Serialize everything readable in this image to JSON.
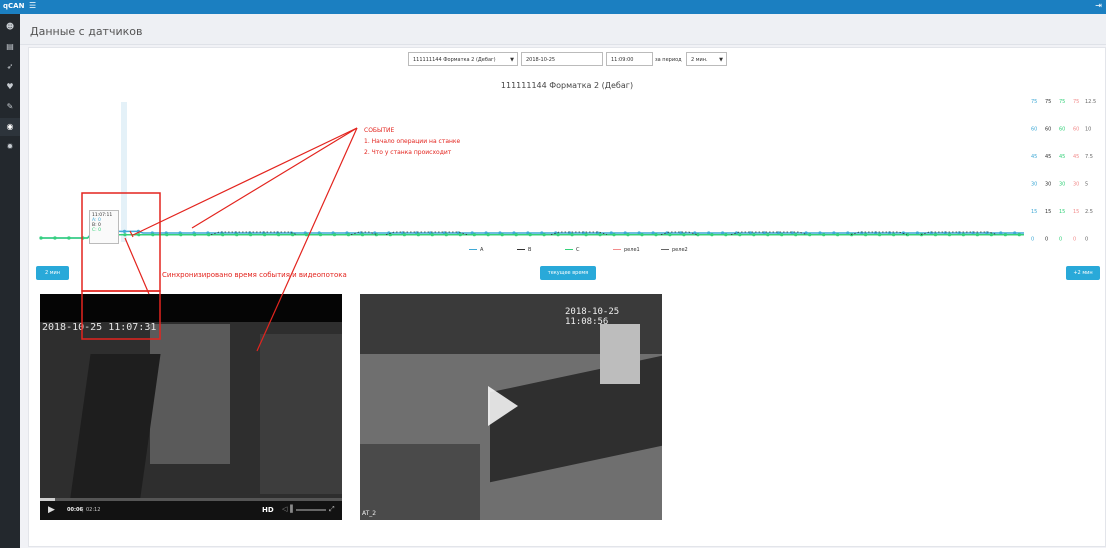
{
  "app": {
    "brand": "qCAN"
  },
  "page": {
    "title": "Данные с датчиков"
  },
  "filters": {
    "device": "111111144 Форматка 2 (Дебаг)",
    "date": "2018-10-25",
    "time": "11:09:00",
    "period_label": "за период",
    "period": "2 мин."
  },
  "chart": {
    "title": "111111144 Форматка 2 (Дебаг)",
    "legend": [
      {
        "name": "A",
        "color": "#3fa9d6"
      },
      {
        "name": "B",
        "color": "#333333"
      },
      {
        "name": "C",
        "color": "#35d17a"
      },
      {
        "name": "реле1",
        "color": "#f28c8c"
      },
      {
        "name": "реле2",
        "color": "#666666"
      }
    ],
    "right_axis_columns": [
      {
        "color": "#3fa9d6",
        "ticks": [
          "75",
          "60",
          "45",
          "30",
          "15",
          "0"
        ]
      },
      {
        "color": "#333333",
        "ticks": [
          "75",
          "60",
          "45",
          "30",
          "15",
          "0"
        ]
      },
      {
        "color": "#35d17a",
        "ticks": [
          "75",
          "60",
          "45",
          "30",
          "15",
          "0"
        ]
      },
      {
        "color": "#f28c8c",
        "ticks": [
          "75",
          "60",
          "45",
          "30",
          "15",
          "0"
        ]
      },
      {
        "color": "#666666",
        "ticks": [
          "12.5",
          "10",
          "7.5",
          "5",
          "2.5",
          "0"
        ]
      }
    ],
    "tooltip": {
      "time": "11:07:11",
      "rows": [
        "A: 0",
        "B: 0",
        "C: 0"
      ]
    }
  },
  "chart_data": {
    "type": "line",
    "series": [
      {
        "name": "A",
        "values": [
          0,
          0,
          0,
          0,
          0,
          0,
          0,
          0,
          0,
          0,
          0,
          3,
          4,
          4,
          4,
          4,
          4,
          4,
          4,
          4,
          4,
          4,
          3,
          3,
          3,
          3,
          3,
          3,
          3,
          3,
          3,
          3,
          3,
          3,
          3,
          3,
          3,
          3,
          3,
          3,
          3,
          3,
          3,
          3,
          3,
          3,
          3,
          3,
          3,
          3,
          3,
          3,
          3,
          3,
          3,
          3,
          3,
          3,
          3,
          3,
          3,
          3,
          3,
          3,
          3,
          3,
          3,
          3,
          3,
          3,
          3,
          3,
          3,
          3,
          3,
          3,
          3,
          3,
          3,
          3,
          3,
          3,
          3,
          3,
          3,
          3,
          3,
          3,
          3,
          3,
          3,
          3,
          3,
          3,
          3,
          3,
          3,
          3,
          3,
          3,
          3,
          3,
          3,
          3,
          3,
          3,
          3,
          3,
          3,
          3,
          3,
          3,
          3,
          3,
          3,
          3,
          3,
          3,
          3,
          3,
          3,
          3,
          3,
          3,
          3,
          3,
          3,
          3,
          3,
          3,
          3,
          3,
          3,
          3,
          3,
          3,
          3,
          3,
          3,
          3,
          3,
          3,
          3,
          3,
          3,
          3,
          3,
          3,
          3,
          3,
          3,
          3,
          3,
          3,
          3,
          3,
          3,
          3,
          3,
          3,
          3,
          3,
          3,
          3,
          3,
          3,
          3,
          3,
          3,
          3,
          3,
          3,
          3,
          3,
          3,
          3,
          3,
          3,
          3,
          3,
          3,
          3,
          3,
          3,
          3,
          3,
          3,
          3,
          3,
          3,
          3,
          3,
          3,
          3,
          3,
          3,
          3,
          3,
          3,
          3,
          3,
          3,
          3,
          3,
          3,
          3,
          3,
          3,
          3,
          3,
          3,
          3,
          3
        ]
      },
      {
        "name": "C",
        "values": [
          0,
          0,
          0,
          0,
          0,
          0,
          0,
          0,
          0,
          0,
          0,
          2,
          2,
          2,
          2,
          2,
          2,
          2,
          2,
          2,
          2,
          2,
          2,
          2,
          2,
          2,
          2,
          2,
          2,
          2,
          2,
          2,
          2,
          2,
          2,
          2,
          2,
          2,
          2,
          2,
          2,
          2,
          2,
          2,
          2,
          2,
          2,
          2,
          2,
          2,
          2,
          2,
          2,
          2,
          2,
          2,
          2,
          2,
          2,
          2,
          2,
          2,
          2,
          2,
          2,
          2,
          2,
          2,
          2,
          2,
          2,
          2,
          2,
          2,
          2,
          2,
          2,
          2,
          2,
          2,
          2,
          2,
          2,
          2,
          2,
          2,
          2,
          2,
          2,
          2,
          2,
          2,
          2,
          2,
          2,
          2,
          2,
          2,
          2,
          2,
          2,
          2,
          2,
          2,
          2,
          2,
          2,
          2,
          2,
          2,
          2,
          2,
          2,
          2,
          2,
          2,
          2,
          2,
          2,
          2,
          2,
          2,
          2,
          2,
          2,
          2,
          2,
          2,
          2,
          2,
          2,
          2,
          2,
          2,
          2,
          2,
          2,
          2,
          2,
          2,
          2,
          2,
          2,
          2,
          2,
          2,
          2,
          2,
          2,
          2,
          2,
          2,
          2,
          2,
          2,
          2,
          2,
          2,
          2,
          2,
          2,
          2,
          2,
          2,
          2,
          2,
          2,
          2,
          2,
          2,
          2,
          2,
          2,
          2,
          2,
          2,
          2,
          2,
          2,
          2,
          2,
          2,
          2,
          2,
          2,
          2,
          2,
          2,
          2,
          2,
          2,
          2,
          2,
          2,
          2,
          2,
          2,
          2,
          2,
          2,
          2,
          2,
          2,
          2,
          2,
          2,
          2,
          2,
          2,
          2,
          2,
          2
        ]
      }
    ],
    "ylim": [
      0,
      75
    ]
  },
  "buttons": {
    "prev": "2 мин",
    "now": "текущее время",
    "next": "+2 мин"
  },
  "annotations": {
    "event_title": "СОБЫТИЕ",
    "event_line1": "1. Начало операции на станке",
    "event_line2": "2. Что у станка происходит",
    "sync_note": "Синхронизировано время события и видеопотока"
  },
  "video1": {
    "overlay": "2018-10-25  11:07:31",
    "time_current": "00:06",
    "time_total": "02:12",
    "hd": "HD"
  },
  "video2": {
    "overlay": "2018-10-25 11:08:56",
    "caption": "AT_2"
  }
}
